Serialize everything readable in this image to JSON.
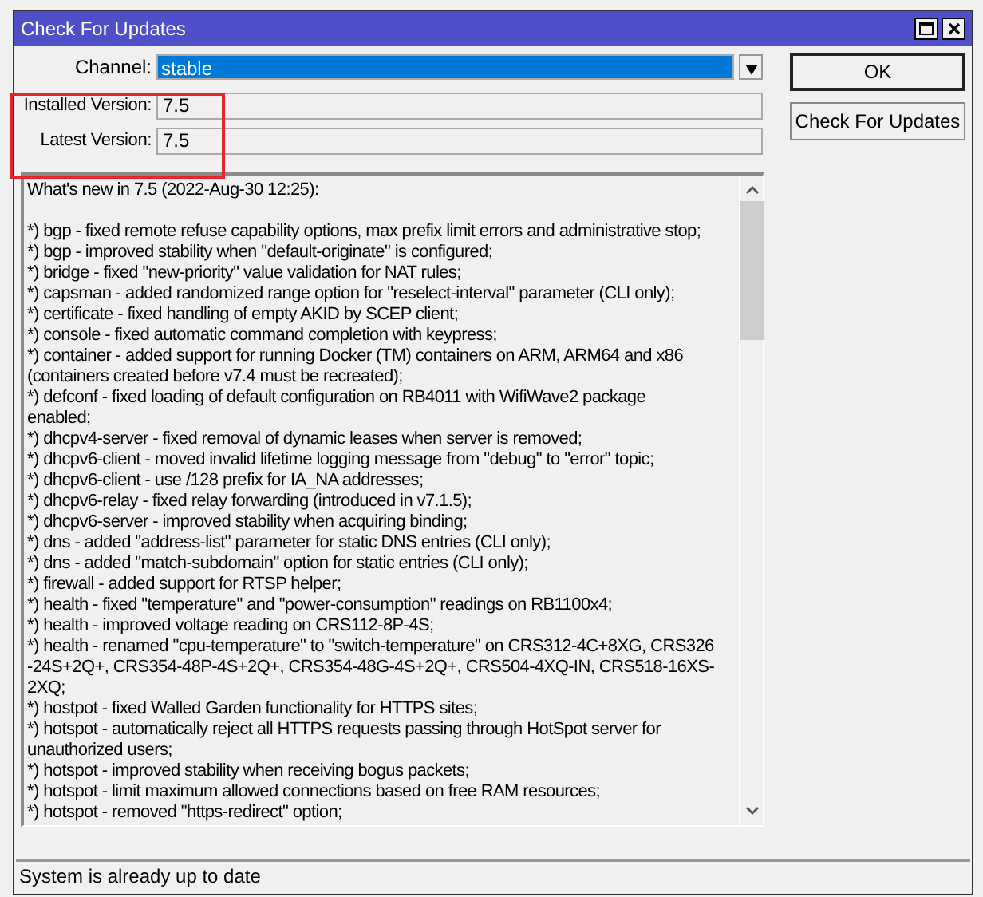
{
  "window": {
    "title": "Check For Updates"
  },
  "form": {
    "channel": {
      "label": "Channel:",
      "value": "stable"
    },
    "installed_version": {
      "label": "Installed Version:",
      "value": "7.5"
    },
    "latest_version": {
      "label": "Latest Version:",
      "value": "7.5"
    }
  },
  "buttons": [
    "OK",
    "Check For Updates"
  ],
  "notes": [
    "What's new in 7.5 (2022-Aug-30 12:25):",
    "*) bgp - fixed remote refuse capability options, max prefix limit errors and administrative stop;",
    "*) bgp - improved stability when \"default-originate\" is configured;",
    "*) bridge - fixed \"new-priority\" value validation for NAT rules;",
    "*) capsman - added randomized range option for \"reselect-interval\" parameter (CLI only);",
    "*) certificate - fixed handling of empty AKID by SCEP client;",
    "*) console - fixed automatic command completion with keypress;",
    "*) container - added support for running Docker (TM) containers on ARM, ARM64 and x86",
    "(containers created before v7.4 must be recreated);",
    "*) defconf - fixed loading of default configuration on RB4011 with WifiWave2 package",
    "enabled;",
    "*) dhcpv4-server - fixed removal of dynamic leases when server is removed;",
    "*) dhcpv6-client - moved invalid lifetime logging message from \"debug\" to \"error\" topic;",
    "*) dhcpv6-client - use /128 prefix for IA_NA addresses;",
    "*) dhcpv6-relay - fixed relay forwarding (introduced in v7.1.5);",
    "*) dhcpv6-server - improved stability when acquiring binding;",
    "*) dns - added \"address-list\" parameter for static DNS entries (CLI only);",
    "*) dns - added \"match-subdomain\" option for static entries (CLI only);",
    "*) firewall - added support for RTSP helper;",
    "*) health - fixed \"temperature\" and \"power-consumption\" readings on RB1100x4;",
    "*) health - improved voltage reading on CRS112-8P-4S;",
    "*) health - renamed \"cpu-temperature\" to \"switch-temperature\" on CRS312-4C+8XG, CRS326",
    "-24S+2Q+, CRS354-48P-4S+2Q+, CRS354-48G-4S+2Q+, CRS504-4XQ-IN, CRS518-16XS-",
    "2XQ;",
    "*) hostpot - fixed Walled Garden functionality for HTTPS sites;",
    "*) hotspot - automatically reject all HTTPS requests passing through HotSpot server for",
    "unauthorized users;",
    "*) hotspot - improved stability when receiving bogus packets;",
    "*) hotspot - limit maximum allowed connections based on free RAM resources;",
    "*) hotspot - removed \"https-redirect\" option;"
  ],
  "status_bar": "System is already up to date"
}
